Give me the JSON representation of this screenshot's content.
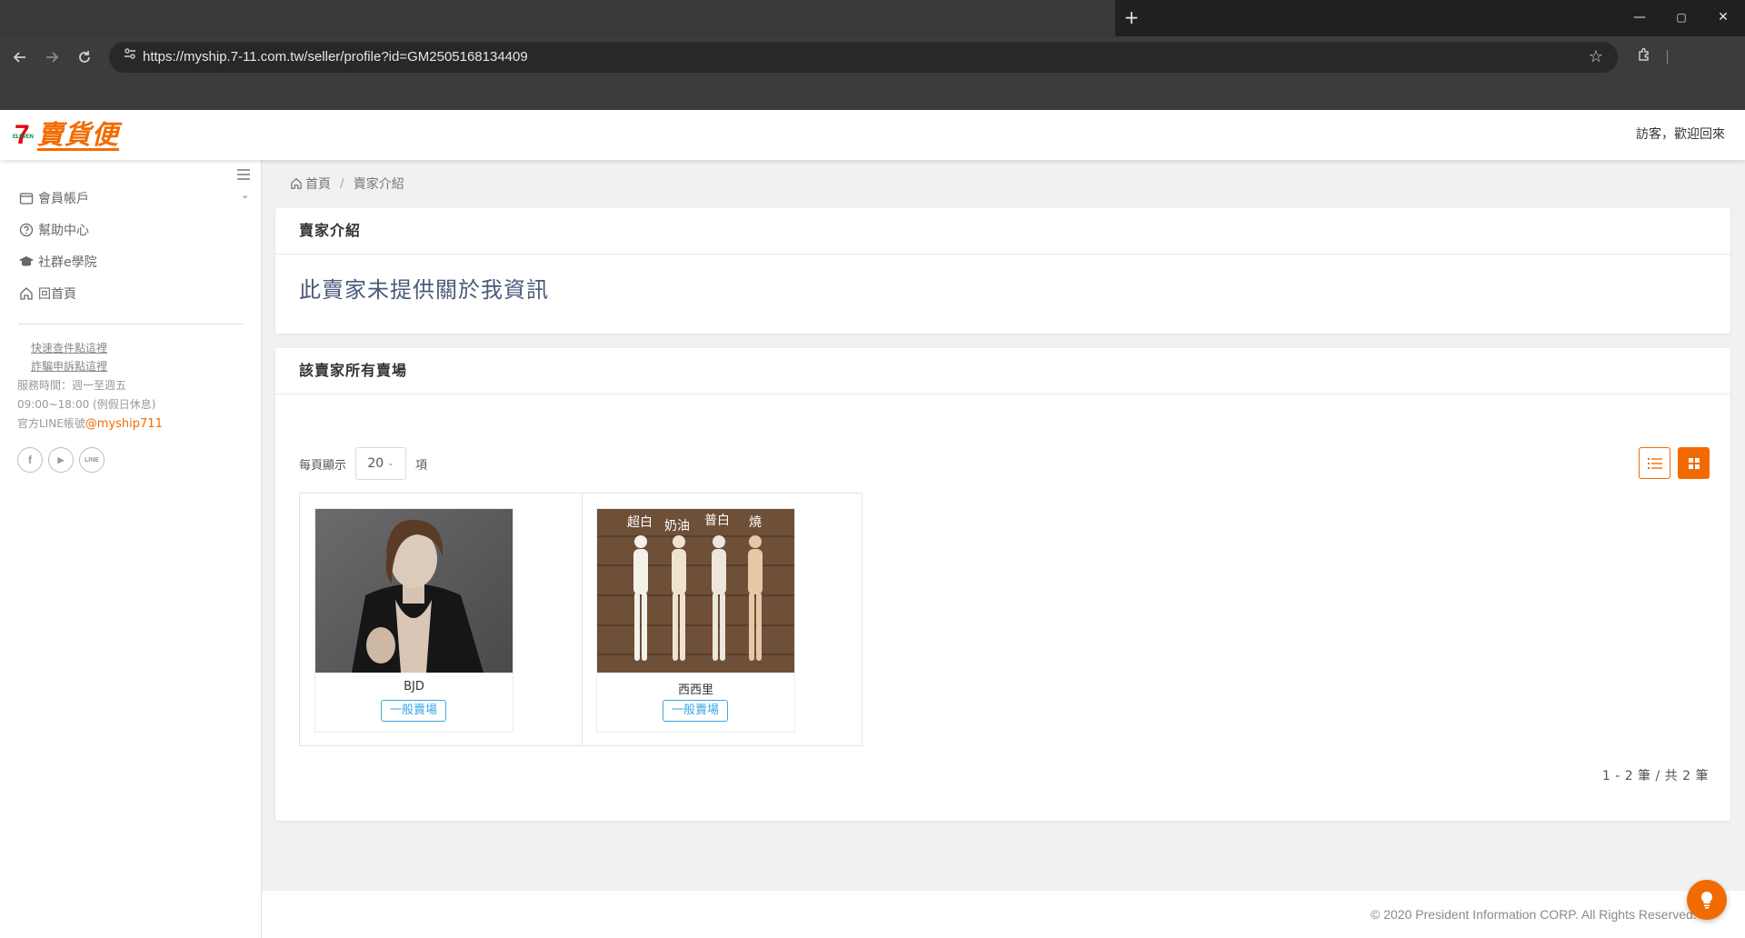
{
  "browser": {
    "new_tab_label": "+",
    "url": "https://myship.7-11.com.tw/seller/profile?id=GM2505168134409",
    "window_controls": {
      "minimize": "—",
      "maximize": "▢",
      "close": "✕"
    }
  },
  "header": {
    "logo_seven": "7",
    "logo_eleven": "ELEVEN",
    "logo_text": "賣貨便",
    "welcome": "訪客，歡迎回來"
  },
  "sidebar": {
    "items": [
      {
        "label": "會員帳戶",
        "icon": "wallet-icon"
      },
      {
        "label": "幫助中心",
        "icon": "help-circle-icon"
      },
      {
        "label": "社群e學院",
        "icon": "graduation-cap-icon"
      },
      {
        "label": "回首頁",
        "icon": "home-icon"
      }
    ],
    "links": [
      "快速查件點這裡",
      "詐騙申訴點這裡"
    ],
    "service_hours_label": "服務時間：週一至週五",
    "service_hours_time": "09:00~18:00 (例假日休息)",
    "line_label": "官方LINE帳號",
    "line_handle": "@myship711",
    "social": [
      {
        "name": "facebook-icon",
        "glyph": "f"
      },
      {
        "name": "youtube-icon",
        "glyph": "▶"
      },
      {
        "name": "line-icon",
        "glyph": "LINE"
      }
    ]
  },
  "breadcrumb": {
    "home": "首頁",
    "separator": "/",
    "current": "賣家介紹"
  },
  "about": {
    "heading": "賣家介紹",
    "text": "此賣家未提供關於我資訊"
  },
  "stores": {
    "heading": "該賣家所有賣場",
    "per_page_label": "每頁顯示",
    "per_page_value": "20",
    "per_page_unit": "項",
    "items": [
      {
        "name": "BJD",
        "tag": "一般賣場"
      },
      {
        "name": "西西里",
        "tag": "一般賣場",
        "image_labels": [
          "超白",
          "奶油",
          "普白",
          "燒"
        ]
      }
    ],
    "pagination": "1 - 2 筆 / 共 2 筆"
  },
  "footer": {
    "copyright": "© 2020 President Information CORP. All Rights Reserved."
  },
  "colors": {
    "accent": "#f26b00",
    "tag": "#3aa7e0",
    "about_text": "#4a5a78"
  }
}
